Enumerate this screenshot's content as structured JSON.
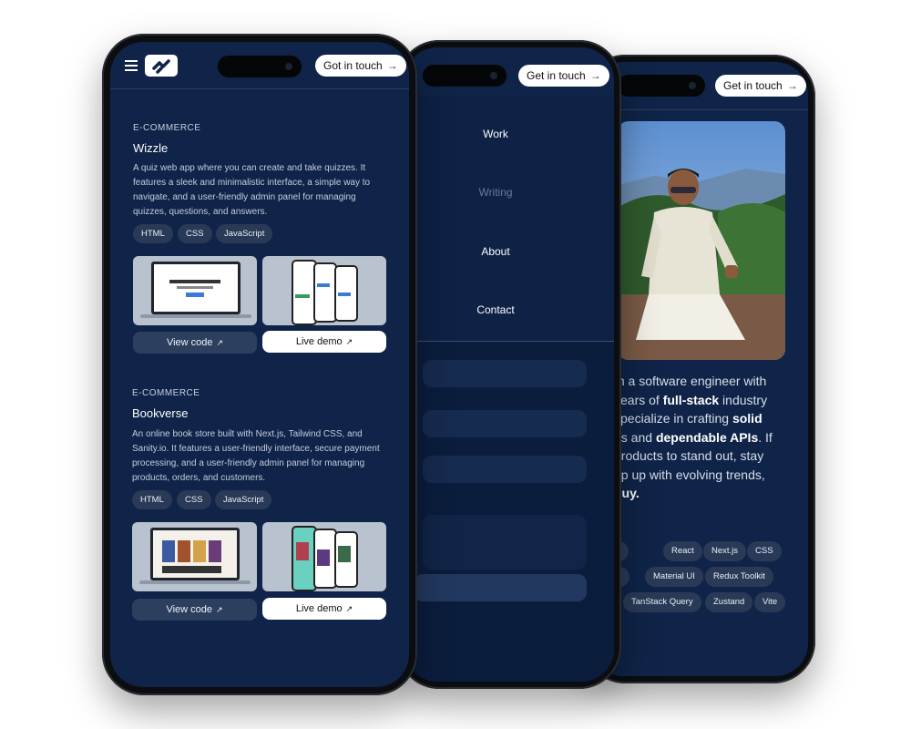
{
  "left_phone": {
    "header": {
      "get_in_touch": "Got in touch",
      "arrow": "→"
    },
    "projects": [
      {
        "category": "E-COMMERCE",
        "title": "Wizzle",
        "description": "A quiz web app where you can create and take quizzes. It features a sleek and minimalistic interface, a simple way to navigate, and a user-friendly admin panel for managing quizzes, questions, and answers.",
        "tags": [
          "HTML",
          "CSS",
          "JavaScript"
        ],
        "view_code": "View code",
        "live_demo": "Live demo"
      },
      {
        "category": "E-COMMERCE",
        "title": "Bookverse",
        "description": "An online book store built with Next.js, Tailwind CSS, and Sanity.io. It features a user-friendly interface, secure payment processing, and a user-friendly admin panel for managing products, orders, and customers.",
        "tags": [
          "HTML",
          "CSS",
          "JavaScript"
        ],
        "view_code": "View code",
        "live_demo": "Live demo"
      }
    ]
  },
  "middle_phone": {
    "header": {
      "get_in_touch": "Get in touch",
      "arrow": "→"
    },
    "nav": [
      "Work",
      "Writing",
      "About",
      "Contact"
    ]
  },
  "right_phone": {
    "header": {
      "get_in_touch": "Get in touch",
      "arrow": "→"
    },
    "about_lines": [
      "m a software engineer with",
      "years of full-stack industry",
      "specialize in crafting solid",
      "es and dependable APIs. If",
      "products to stand out, stay",
      "ep up with evolving trends,",
      "guy."
    ],
    "skills": [
      "aScript",
      "React",
      "Next.js",
      "CSS",
      "Sass",
      "Material UI",
      "Redux Toolkit",
      "TanStack Query",
      "Zustand",
      "Vite"
    ]
  },
  "colors": {
    "screen_bg": "#0f2448",
    "tag_bg": "#2a3a56",
    "frame": "#0c0d10"
  }
}
